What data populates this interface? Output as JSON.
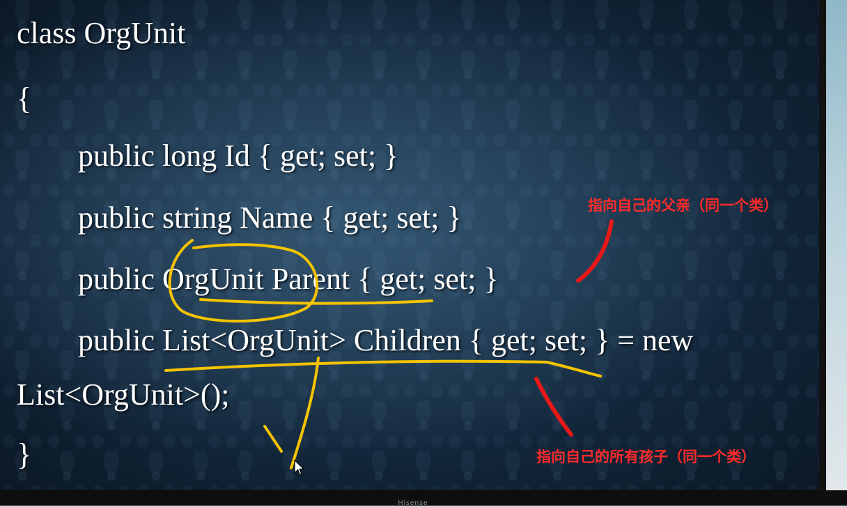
{
  "slide": {
    "code_lines": [
      "class OrgUnit",
      "{",
      "public long Id { get; set; }",
      "public string Name { get; set; }",
      "public OrgUnit Parent { get; set; }",
      "public List<OrgUnit> Children { get; set; } = new",
      "List<OrgUnit>();",
      "}"
    ],
    "annotations": {
      "parent_note": "指向自己的父亲（同一个类）",
      "children_note": "指向自己的所有孩子（同一个类）"
    }
  },
  "monitor": {
    "brand": "Hisense"
  },
  "colors": {
    "code_text": "#ffffff",
    "annotation_text": "#ff2a2a",
    "highlight_ink": "#f5c400",
    "arrow_ink": "#e81818",
    "slide_bg": "#1a3148"
  },
  "icons": [
    "mouse-cursor-icon"
  ]
}
